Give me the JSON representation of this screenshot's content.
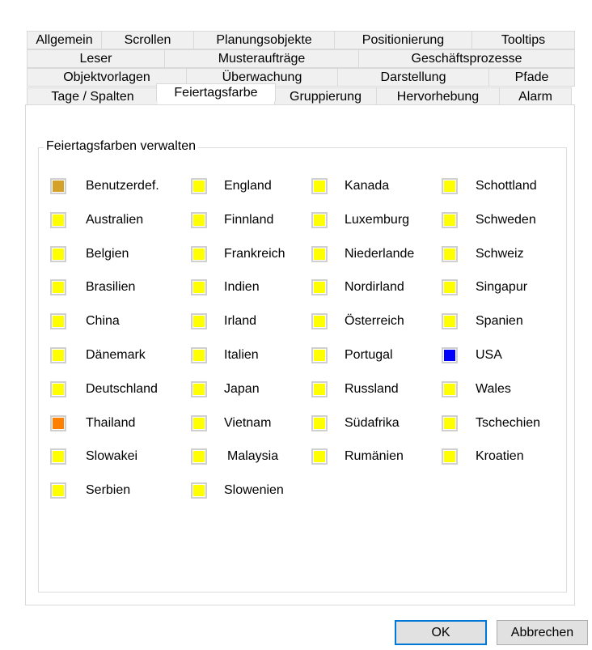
{
  "tabs": {
    "row1": [
      "Allgemein",
      "Scrollen",
      "Planungsobjekte",
      "Positionierung",
      "Tooltips"
    ],
    "row2": [
      "Leser",
      "Musteraufträge",
      "Geschäftsprozesse"
    ],
    "row3": [
      "Objektvorlagen",
      "Überwachung",
      "Darstellung",
      "Pfade"
    ],
    "row4": [
      "Tage / Spalten",
      "Feiertagsfarbe",
      "Gruppierung",
      "Hervorhebung",
      "Alarm"
    ],
    "active": "Feiertagsfarbe"
  },
  "group_title": "Feiertagsfarben verwalten",
  "colors": {
    "yellow": "#ffff00",
    "custom": "#d4a129",
    "orange": "#ff7f00",
    "blue": "#0000ff"
  },
  "countries": [
    {
      "label": "Benutzerdef.",
      "color": "#d4a129"
    },
    {
      "label": "Australien",
      "color": "#ffff00"
    },
    {
      "label": "Belgien",
      "color": "#ffff00"
    },
    {
      "label": "Brasilien",
      "color": "#ffff00"
    },
    {
      "label": "China",
      "color": "#ffff00"
    },
    {
      "label": "Dänemark",
      "color": "#ffff00"
    },
    {
      "label": "Deutschland",
      "color": "#ffff00"
    },
    {
      "label": "Thailand",
      "color": "#ff7f00"
    },
    {
      "label": "Slowakei",
      "color": "#ffff00"
    },
    {
      "label": "Serbien",
      "color": "#ffff00"
    },
    {
      "label": "England",
      "color": "#ffff00"
    },
    {
      "label": "Finnland",
      "color": "#ffff00"
    },
    {
      "label": "Frankreich",
      "color": "#ffff00"
    },
    {
      "label": "Indien",
      "color": "#ffff00"
    },
    {
      "label": "Irland",
      "color": "#ffff00"
    },
    {
      "label": "Italien",
      "color": "#ffff00"
    },
    {
      "label": "Japan",
      "color": "#ffff00"
    },
    {
      "label": "Vietnam",
      "color": "#ffff00"
    },
    {
      "label": "Malaysia",
      "color": "#ffff00"
    },
    {
      "label": "Slowenien",
      "color": "#ffff00"
    },
    {
      "label": "Kanada",
      "color": "#ffff00"
    },
    {
      "label": "Luxemburg",
      "color": "#ffff00"
    },
    {
      "label": "Niederlande",
      "color": "#ffff00"
    },
    {
      "label": "Nordirland",
      "color": "#ffff00"
    },
    {
      "label": "Österreich",
      "color": "#ffff00"
    },
    {
      "label": "Portugal",
      "color": "#ffff00"
    },
    {
      "label": "Russland",
      "color": "#ffff00"
    },
    {
      "label": "Südafrika",
      "color": "#ffff00"
    },
    {
      "label": "Rumänien",
      "color": "#ffff00"
    },
    {
      "label": "Schottland",
      "color": "#ffff00"
    },
    {
      "label": "Schweden",
      "color": "#ffff00"
    },
    {
      "label": "Schweiz",
      "color": "#ffff00"
    },
    {
      "label": "Singapur",
      "color": "#ffff00"
    },
    {
      "label": "Spanien",
      "color": "#ffff00"
    },
    {
      "label": "USA",
      "color": "#0000ff"
    },
    {
      "label": "Wales",
      "color": "#ffff00"
    },
    {
      "label": "Tschechien",
      "color": "#ffff00"
    },
    {
      "label": "Kroatien",
      "color": "#ffff00"
    }
  ],
  "buttons": {
    "ok": "OK",
    "cancel": "Abbrechen"
  }
}
